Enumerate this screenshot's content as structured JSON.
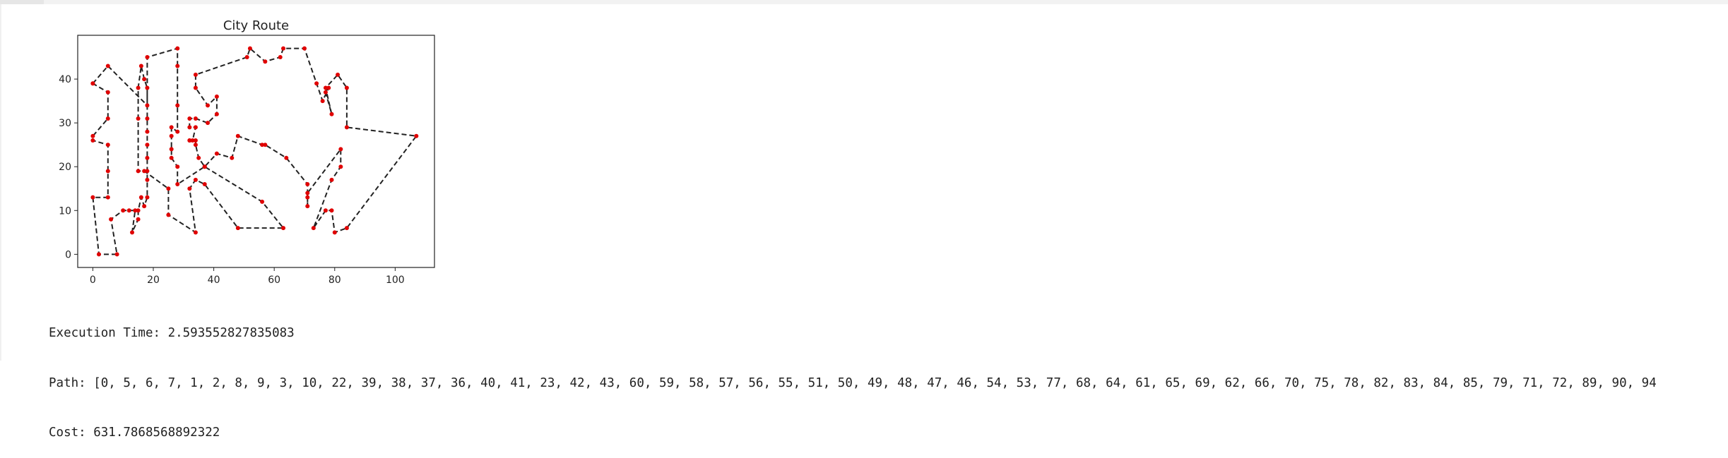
{
  "chart_data": {
    "type": "line",
    "title": "City Route",
    "xlabel": "",
    "ylabel": "",
    "xlim": [
      -5,
      113
    ],
    "ylim": [
      -3,
      50
    ],
    "x_ticks": [
      0,
      20,
      40,
      60,
      80,
      100
    ],
    "y_ticks": [
      0,
      10,
      20,
      30,
      40
    ],
    "grid": false,
    "line_color": "#222222",
    "line_style": "dashed",
    "marker_color": "#e00000",
    "route": [
      [
        0,
        39
      ],
      [
        5,
        43
      ],
      [
        18,
        34
      ],
      [
        18,
        45
      ],
      [
        28,
        47
      ],
      [
        28,
        43
      ],
      [
        28,
        34
      ],
      [
        28,
        28
      ],
      [
        26,
        29
      ],
      [
        26,
        27
      ],
      [
        26,
        24
      ],
      [
        26,
        22
      ],
      [
        28,
        20
      ],
      [
        28,
        16
      ],
      [
        37,
        20
      ],
      [
        41,
        23
      ],
      [
        46,
        22
      ],
      [
        48,
        27
      ],
      [
        56,
        25
      ],
      [
        57,
        25
      ],
      [
        64,
        22
      ],
      [
        71,
        16
      ],
      [
        71,
        13
      ],
      [
        71,
        11
      ],
      [
        71,
        14
      ],
      [
        82,
        24
      ],
      [
        82,
        20
      ],
      [
        79,
        17
      ],
      [
        73,
        6
      ],
      [
        77,
        10
      ],
      [
        79,
        10
      ],
      [
        80,
        5
      ],
      [
        84,
        6
      ],
      [
        107,
        27
      ],
      [
        84,
        29
      ],
      [
        84,
        38
      ],
      [
        81,
        41
      ],
      [
        77,
        38
      ],
      [
        79,
        32
      ],
      [
        77,
        37
      ],
      [
        78,
        38
      ],
      [
        76,
        35
      ],
      [
        74,
        39
      ],
      [
        70,
        47
      ],
      [
        63,
        47
      ],
      [
        62,
        45
      ],
      [
        57,
        44
      ],
      [
        52,
        47
      ],
      [
        51,
        45
      ],
      [
        34,
        41
      ],
      [
        34,
        38
      ],
      [
        38,
        34
      ],
      [
        41,
        36
      ],
      [
        41,
        32
      ],
      [
        38,
        30
      ],
      [
        34,
        31
      ],
      [
        32,
        31
      ],
      [
        32,
        29
      ],
      [
        34,
        29
      ],
      [
        33,
        26
      ],
      [
        32,
        26
      ],
      [
        32,
        26
      ],
      [
        34,
        26
      ],
      [
        34,
        25
      ],
      [
        35,
        22
      ],
      [
        37,
        20
      ],
      [
        56,
        12
      ],
      [
        63,
        6
      ],
      [
        48,
        6
      ],
      [
        37,
        16
      ],
      [
        34,
        17
      ],
      [
        32,
        15
      ],
      [
        34,
        5
      ],
      [
        25,
        9
      ],
      [
        25,
        15
      ],
      [
        17,
        19
      ],
      [
        15,
        19
      ],
      [
        15,
        31
      ],
      [
        15,
        38
      ],
      [
        16,
        43
      ],
      [
        17,
        40
      ],
      [
        18,
        38
      ],
      [
        18,
        31
      ],
      [
        18,
        28
      ],
      [
        18,
        25
      ],
      [
        18,
        22
      ],
      [
        18,
        19
      ],
      [
        18,
        17
      ],
      [
        18,
        13
      ],
      [
        17,
        11
      ],
      [
        16,
        13
      ],
      [
        15,
        10
      ],
      [
        15,
        8
      ],
      [
        13,
        5
      ],
      [
        14,
        10
      ],
      [
        12,
        10
      ],
      [
        10,
        10
      ],
      [
        6,
        8
      ],
      [
        8,
        0
      ],
      [
        2,
        0
      ],
      [
        0,
        13
      ],
      [
        5,
        13
      ],
      [
        5,
        19
      ],
      [
        5,
        25
      ],
      [
        0,
        26
      ],
      [
        0,
        27
      ],
      [
        5,
        31
      ],
      [
        5,
        37
      ],
      [
        0,
        39
      ]
    ]
  },
  "output": {
    "execution_time": "Execution Time: 2.593552827835083",
    "path": "Path: [0, 5, 6, 7, 1, 2, 8, 9, 3, 10, 22, 39, 38, 37, 36, 40, 41, 23, 42, 43, 60, 59, 58, 57, 56, 55, 51, 50, 49, 48, 47, 46, 54, 53, 77, 68, 64, 61, 65, 69, 62, 66, 70, 75, 78, 82, 83, 84, 85, 79, 71, 72, 89, 90, 94",
    "cost": "Cost: 631.7868568892322"
  }
}
